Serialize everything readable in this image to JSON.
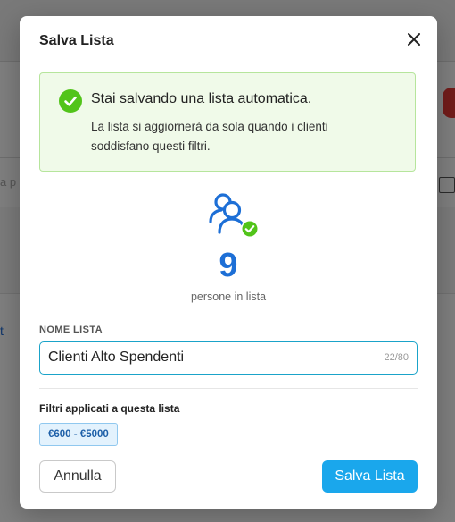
{
  "background": {
    "search_placeholder": "a p",
    "link_text": "t"
  },
  "modal": {
    "title": "Salva Lista",
    "close_icon": "close-icon"
  },
  "alert": {
    "icon": "check-circle-icon",
    "title": "Stai salvando una lista automatica.",
    "text": "La lista si aggiornerà da sola quando i clienti soddisfano questi filtri.",
    "color_bg": "#f0fae9",
    "color_icon": "#52c41a"
  },
  "summary": {
    "icon": "users-check-icon",
    "count": "9",
    "count_label": "persone in lista",
    "accent": "#1d6fd6"
  },
  "name_field": {
    "label": "NOME LISTA",
    "value": "Clienti Alto Spendenti",
    "counter": "22/80"
  },
  "filters": {
    "title": "Filtri applicati a questa lista",
    "items": [
      "€600 - €5000"
    ]
  },
  "actions": {
    "cancel_label": "Annulla",
    "save_label": "Salva Lista",
    "save_color": "#1aa7ec"
  }
}
